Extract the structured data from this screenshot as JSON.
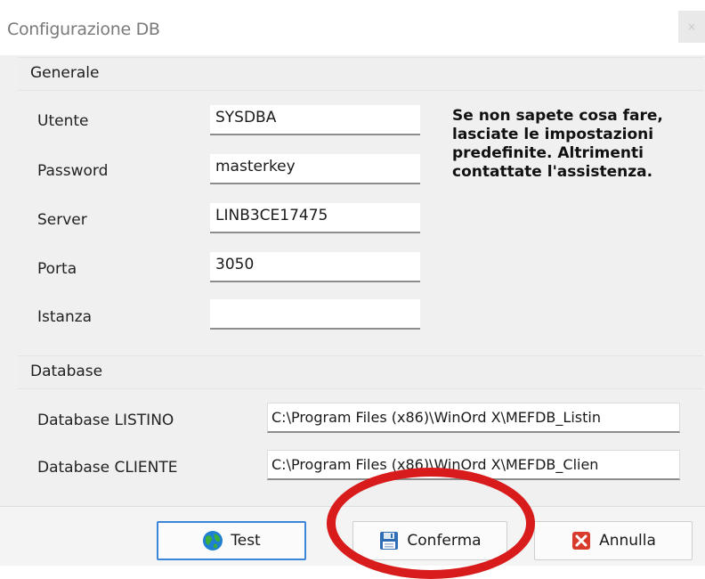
{
  "window": {
    "title": "Configurazione DB",
    "close_label": "×"
  },
  "generale": {
    "title": "Generale",
    "fields": [
      {
        "label": "Utente",
        "value": "SYSDBA"
      },
      {
        "label": "Password",
        "value": "masterkey"
      },
      {
        "label": "Server",
        "value": "LINB3CE17475"
      },
      {
        "label": "Porta",
        "value": "3050"
      },
      {
        "label": "Istanza",
        "value": ""
      }
    ],
    "note": "Se non sapete cosa fare, lasciate le impostazioni predefinite. Altrimenti contattate l'assistenza."
  },
  "database": {
    "title": "Database",
    "fields": [
      {
        "label": "Database LISTINO",
        "value": "C:\\Program Files (x86)\\WinOrd X\\MEFDB_Listin"
      },
      {
        "label": "Database CLIENTE",
        "value": "C:\\Program Files (x86)\\WinOrd X\\MEFDB_Clien"
      }
    ]
  },
  "buttons": {
    "test": {
      "label": "Test",
      "icon": "globe-icon"
    },
    "conferma": {
      "label": "Conferma",
      "icon": "floppy-disk-icon"
    },
    "annulla": {
      "label": "Annulla",
      "icon": "red-x-icon"
    }
  },
  "annotation": {
    "highlight_color": "#d81b1b",
    "highlighted_target": "conferma"
  }
}
